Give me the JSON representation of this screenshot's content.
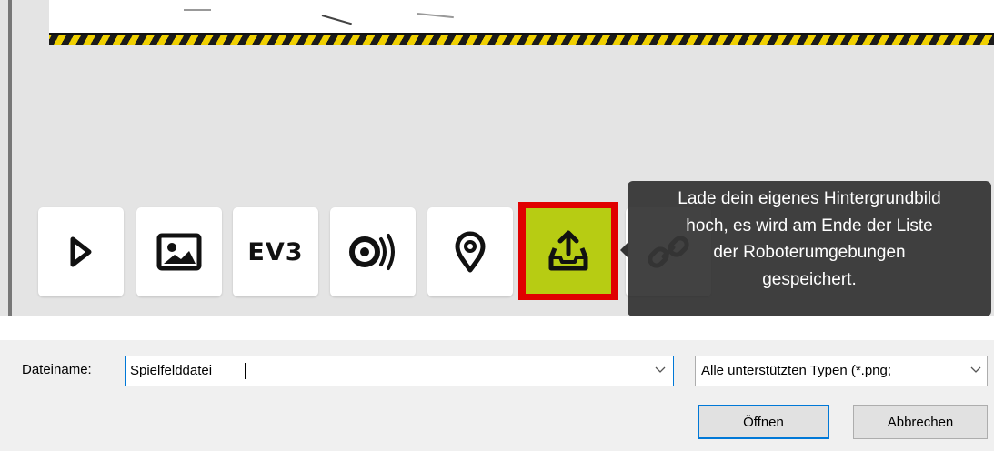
{
  "toolbar": {
    "buttons": [
      {
        "name": "play",
        "icon": "play-outline-icon"
      },
      {
        "name": "image",
        "icon": "image-icon"
      },
      {
        "name": "ev3",
        "icon": "ev3-logo-icon",
        "label": "EV3"
      },
      {
        "name": "sound",
        "icon": "sound-sensor-icon"
      },
      {
        "name": "location",
        "icon": "location-pin-icon"
      },
      {
        "name": "upload",
        "icon": "upload-tray-icon",
        "highlight_color": "#b7cc13",
        "selection_color": "#e00000"
      },
      {
        "name": "link",
        "icon": "link-icon"
      }
    ]
  },
  "tooltip": {
    "lines": [
      "Lade dein eigenes Hintergrundbild",
      "hoch, es wird am Ende der Liste",
      "der Roboterumgebungen",
      "gespeichert."
    ]
  },
  "file_dialog": {
    "filename_label": "Dateiname:",
    "filename_value": "Spielfelddatei",
    "file_type": "Alle unterstützten Typen (*.png;",
    "open_label": "Öffnen",
    "cancel_label": "Abbrechen",
    "accent_color": "#0078d7"
  }
}
